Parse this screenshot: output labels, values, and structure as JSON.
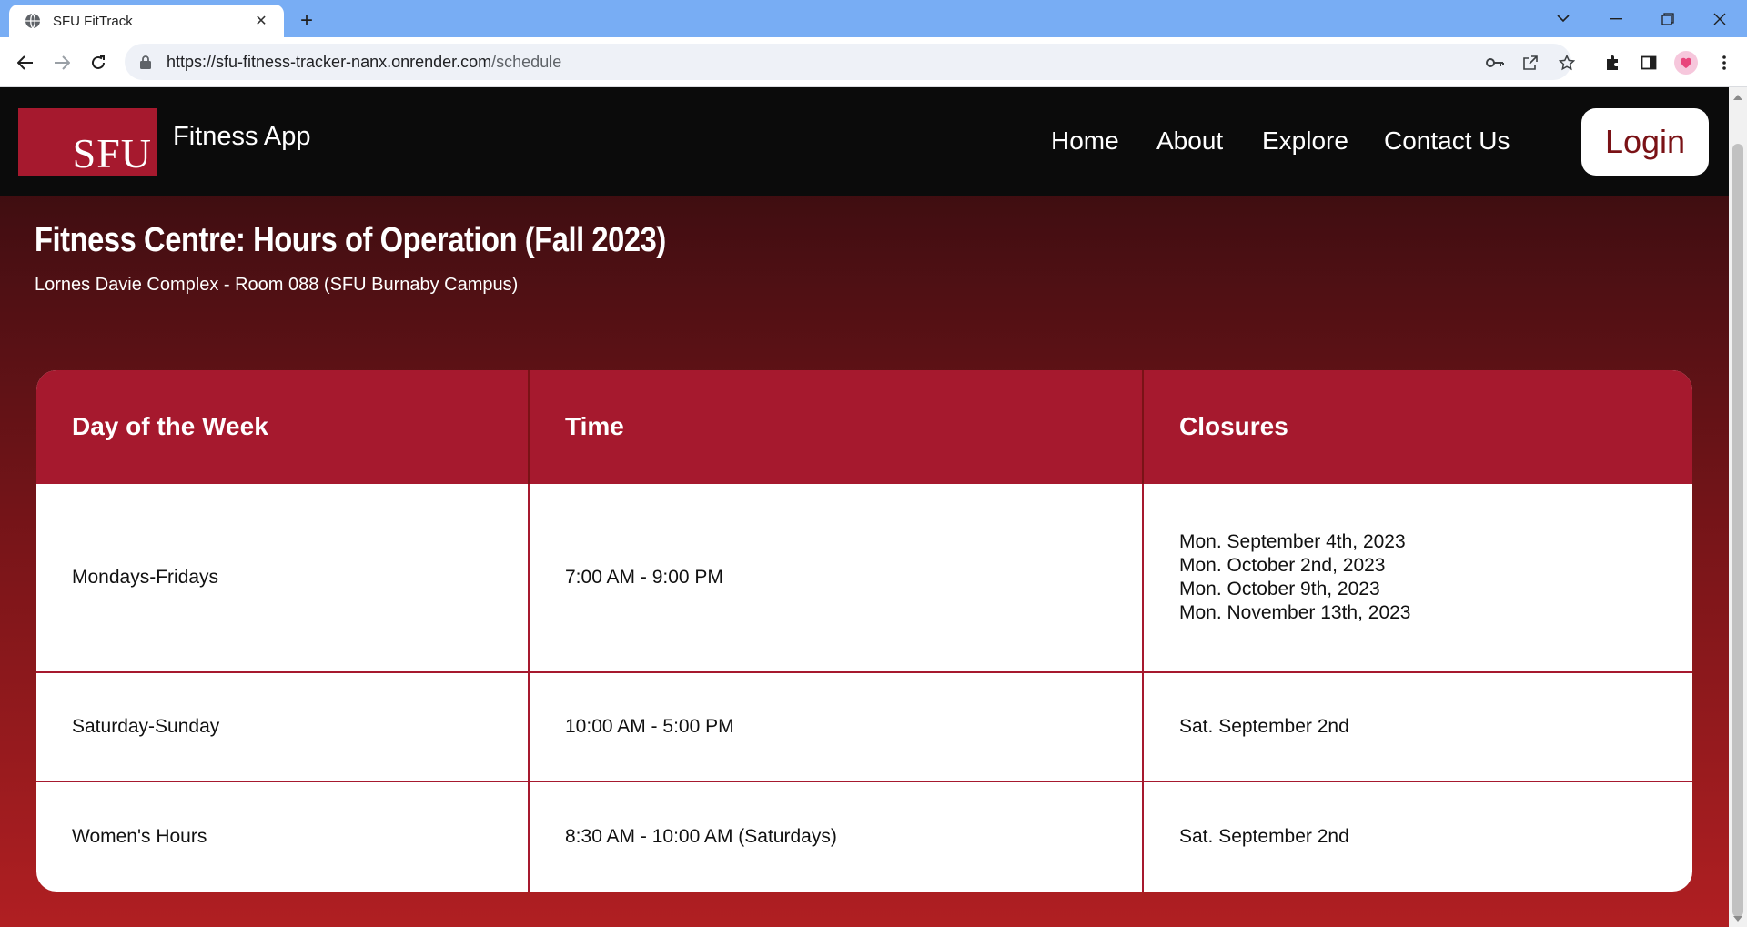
{
  "browser": {
    "tab_title": "SFU FitTrack",
    "url_host": "https://sfu-fitness-tracker-nanx.onrender.com",
    "url_path": "/schedule"
  },
  "site": {
    "logo_text": "SFU",
    "app_name": "Fitness App",
    "nav": [
      "Home",
      "About",
      "Explore",
      "Contact Us"
    ],
    "login_label": "Login"
  },
  "schedule": {
    "title": "Fitness Centre: Hours of Operation (Fall 2023)",
    "subtitle": "Lornes Davie Complex - Room 088 (SFU Burnaby Campus)",
    "columns": [
      "Day of the Week",
      "Time",
      "Closures"
    ],
    "rows": [
      {
        "day": "Mondays-Fridays",
        "time": "7:00 AM - 9:00 PM",
        "closures": [
          "Mon. September 4th, 2023",
          "Mon. October 2nd, 2023",
          "Mon. October 9th, 2023",
          "Mon. November 13th, 2023"
        ]
      },
      {
        "day": "Saturday-Sunday",
        "time": "10:00 AM - 5:00 PM",
        "closures": [
          "Sat. September 2nd"
        ]
      },
      {
        "day": "Women's Hours",
        "time": "8:30 AM - 10:00 AM (Saturdays)",
        "closures": [
          "Sat. September 2nd"
        ]
      }
    ]
  },
  "colors": {
    "brand_red": "#a6192e",
    "header_black": "#0b0b0b",
    "chrome_blue": "#78adf4"
  }
}
